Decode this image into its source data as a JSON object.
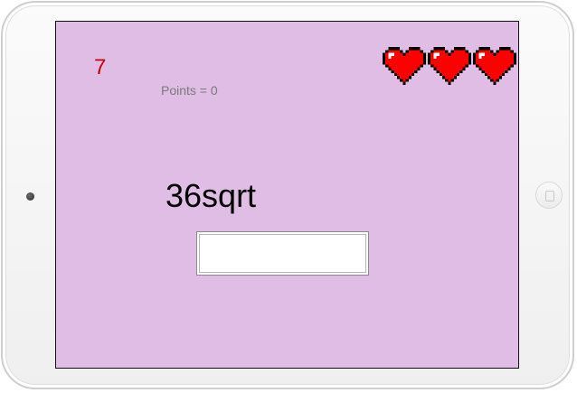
{
  "game": {
    "timer": "7",
    "points_label": "Points = 0",
    "question": "36sqrt",
    "answer_value": "",
    "lives": 3
  },
  "colors": {
    "screen_background": "#e0bde4",
    "timer": "#cc0000",
    "heart": "#ff0000"
  },
  "icons": [
    "heart-icon",
    "camera-icon",
    "home-button-icon"
  ]
}
